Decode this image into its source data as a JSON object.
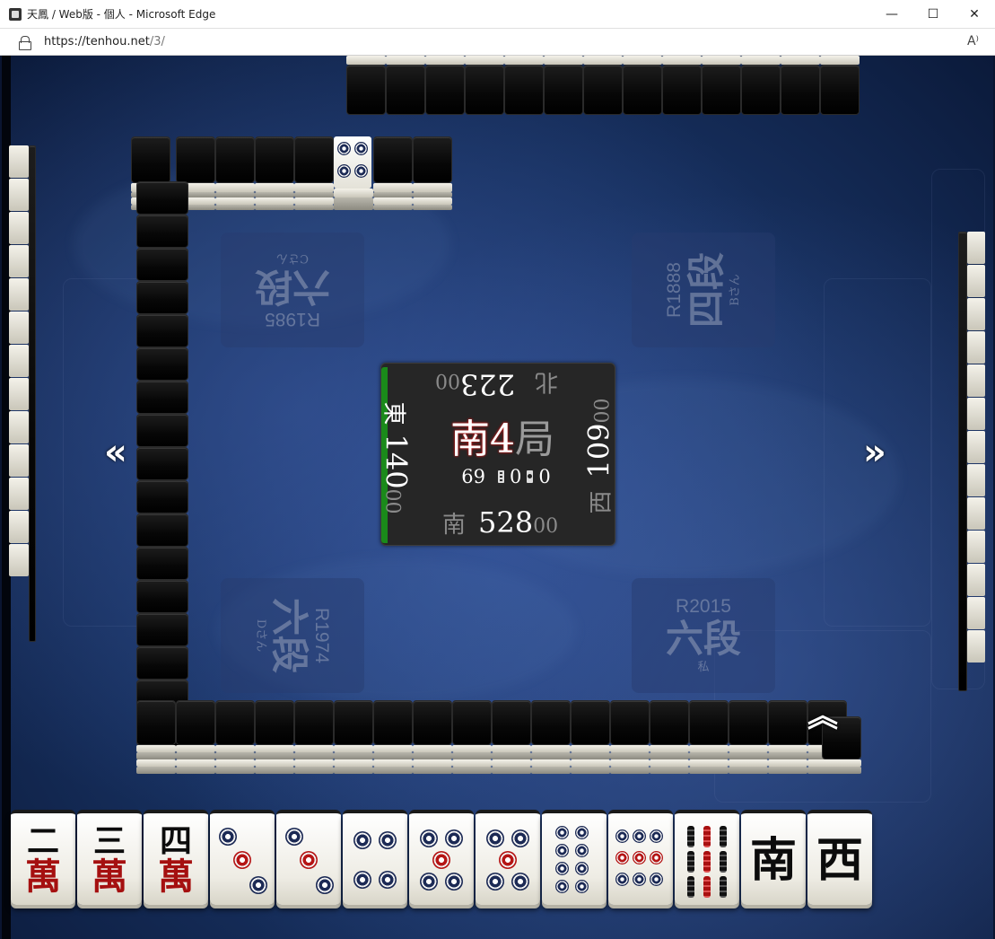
{
  "window": {
    "title": "天鳳 / Web版 - 個人 - Microsoft Edge",
    "minimize_icon": "minimize-icon",
    "maximize_icon": "maximize-icon",
    "close_icon": "close-icon"
  },
  "address": {
    "scheme_host": "https://tenhou.net",
    "path": "/3/",
    "read_aloud_label": "A⁾"
  },
  "players": {
    "top": {
      "rating": "R1985",
      "rank": "六段",
      "name": "Cさん"
    },
    "right": {
      "rating": "R1888",
      "rank": "四段",
      "name": "Bさん"
    },
    "left": {
      "rating": "R1974",
      "rank": "六段",
      "name": "Dさん"
    },
    "bottom": {
      "rating": "R2015",
      "rank": "六段",
      "name": "私"
    }
  },
  "center": {
    "round_wind": "南",
    "round_number": "4",
    "round_suffix": "局",
    "tiles_left": "69",
    "honba": "0",
    "riichi": "0",
    "seats": {
      "bottom": {
        "wind": "南",
        "score": "528",
        "small": "00"
      },
      "left": {
        "wind": "東",
        "score": "140",
        "small": "00"
      },
      "top": {
        "wind": "北",
        "score": "223",
        "small": "00"
      },
      "right": {
        "wind": "西",
        "score": "109",
        "small": "00"
      }
    },
    "active_seat": "left"
  },
  "nav": {
    "prev": "«",
    "next": "»",
    "up": "︽"
  },
  "hand": [
    {
      "kind": "man",
      "num": "二",
      "char": "萬"
    },
    {
      "kind": "man",
      "num": "三",
      "char": "萬"
    },
    {
      "kind": "man",
      "num": "四",
      "char": "萬"
    },
    {
      "kind": "pin",
      "value": 3
    },
    {
      "kind": "pin",
      "value": 3
    },
    {
      "kind": "pin",
      "value": 4
    },
    {
      "kind": "pin",
      "value": 5
    },
    {
      "kind": "pin",
      "value": 5
    },
    {
      "kind": "pin",
      "value": 8
    },
    {
      "kind": "pin",
      "value": 9
    },
    {
      "kind": "sou",
      "value": 9
    },
    {
      "kind": "honor",
      "char": "南"
    },
    {
      "kind": "honor",
      "char": "西"
    }
  ],
  "open_meld": {
    "tile": "4-pin",
    "pips": 4
  },
  "colors": {
    "table": "#1c3568",
    "turn_indicator": "#1a8a1a",
    "man_red": "#a51010",
    "pin_blue": "#1c2a55"
  }
}
